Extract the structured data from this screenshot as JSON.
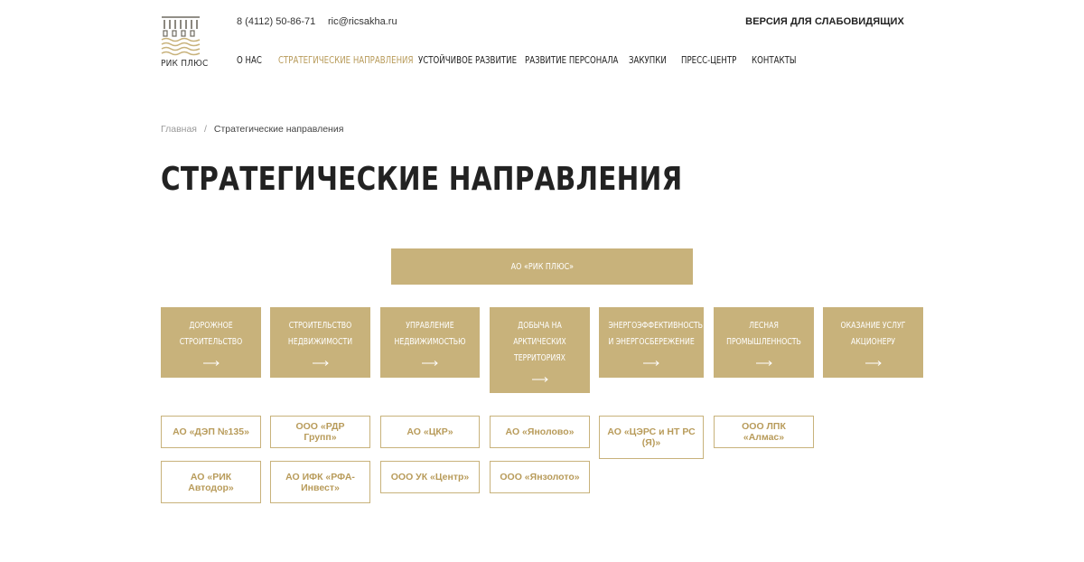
{
  "header": {
    "logo_text": "РИК ПЛЮС",
    "phone": "8 (4112) 50-86-71",
    "email": "ric@ricsakha.ru",
    "vision_link": "ВЕРСИЯ ДЛЯ СЛАБОВИДЯЩИХ",
    "nav": [
      {
        "label": "О НАС"
      },
      {
        "label": "СТРАТЕГИЧЕСКИЕ НАПРАВЛЕНИЯ",
        "active": true
      },
      {
        "label": "УСТОЙЧИВОЕ РАЗВИТИЕ"
      },
      {
        "label": "РАЗВИТИЕ ПЕРСОНАЛА"
      },
      {
        "label": "ЗАКУПКИ"
      },
      {
        "label": "ПРЕСС-ЦЕНТР"
      },
      {
        "label": "КОНТАКТЫ"
      }
    ]
  },
  "breadcrumb": {
    "home": "Главная",
    "separator": "/",
    "current": "Стратегические направления"
  },
  "page_title": "СТРАТЕГИЧЕСКИЕ НАПРАВЛЕНИЯ",
  "structure": {
    "root": "АО «РИК ПЛЮС»",
    "directions": [
      {
        "line1": "ДОРОЖНОЕ",
        "line2": "СТРОИТЕЛЬСТВО"
      },
      {
        "line1": "СТРОИТЕЛЬСТВО",
        "line2": "НЕДВИЖИМОСТИ"
      },
      {
        "line1": "УПРАВЛЕНИЕ",
        "line2": "НЕДВИЖИМОСТЬЮ"
      },
      {
        "line1": "ДОБЫЧА НА",
        "line2": "АРКТИЧЕСКИХ",
        "line3": "ТЕРРИТОРИЯХ"
      },
      {
        "line1": "ЭНЕРГОЭФФЕКТИВНОСТЬ",
        "line2": "И ЭНЕРГОСБЕРЕЖЕНИЕ"
      },
      {
        "line1": "ЛЕСНАЯ",
        "line2": "ПРОМЫШЛЕННОСТЬ"
      },
      {
        "line1": "ОКАЗАНИЕ УСЛУГ",
        "line2": "АКЦИОНЕРУ"
      }
    ],
    "companies": [
      {
        "line1": "АО «ДЭП №135»"
      },
      {
        "line1": "ООО «РДР Групп»"
      },
      {
        "line1": "АО «ЦКР»"
      },
      {
        "line1": "АО «Янолово»"
      },
      {
        "line1": "АО «ЦЭРС и НТ РС",
        "line2": "(Я)»"
      },
      {
        "line1": "ООО ЛПК «Алмас»"
      },
      {
        "line1": "АО «РИК",
        "line2": "Автодор»"
      },
      {
        "line1": "АО ИФК «РФА-",
        "line2": "Инвест»"
      },
      {
        "line1": "ООО УК «Центр»"
      },
      {
        "line1": "ООО «Янзолото»"
      }
    ]
  },
  "colors": {
    "accent": "#c8b27b",
    "accent_text": "#b89b5a",
    "text": "#222222"
  }
}
